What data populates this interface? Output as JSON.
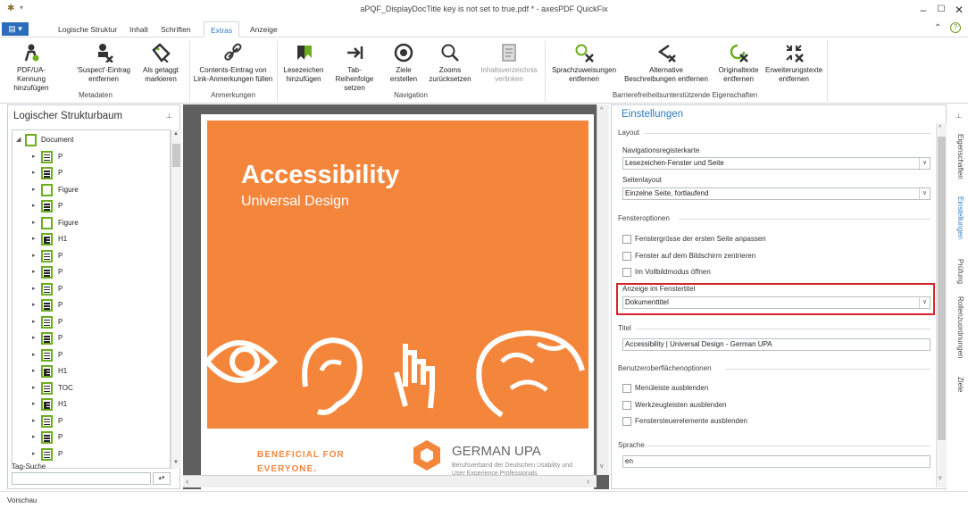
{
  "window": {
    "title": "aPQF_DisplayDocTitle key is not set to true.pdf * - axesPDF QuickFix",
    "minimize": "–",
    "maximize": "☐",
    "close": "✕"
  },
  "menu": {
    "app_button": "▤ ▾",
    "tabs": [
      "Logische Struktur",
      "Inhalt",
      "Schriften",
      "Extras",
      "Anzeige"
    ],
    "active_tab": "Extras",
    "collapse": "⌃",
    "help": "?"
  },
  "ribbon": {
    "metadaten": {
      "label": "Metadaten",
      "buttons": [
        "PDF/UA-Kennung\nhinzufügen",
        "'Suspect'-Eintrag\nentfernen",
        "Als getaggt\nmarkieren"
      ]
    },
    "anmerkungen": {
      "label": "Anmerkungen",
      "buttons": [
        "Contents-Eintrag von\nLink-Anmerkungen füllen"
      ]
    },
    "navigation": {
      "label": "Navigation",
      "buttons": [
        "Lesezeichen\nhinzufügen",
        "Tab-Reihenfolge\nsetzen",
        "Ziele\nerstellen",
        "Zooms\nzurücksetzen",
        "Inhaltsverzeichnis\nverlinken"
      ]
    },
    "barrierefreiheit": {
      "label": "Barrierefreiheitsunterstützende Eigenschaften",
      "buttons": [
        "Sprachzuweisungen\nentfernen",
        "Alternative\nBeschreibungen entfernen",
        "Originaltexte\nentfernen",
        "Erweiterungstexte\nentfernen"
      ]
    }
  },
  "left_panel": {
    "title": "Logischer Strukturbaum",
    "pin": "⊥",
    "tree": [
      {
        "label": "Document",
        "icon": "document"
      },
      {
        "label": "P",
        "icon": "paragraph"
      },
      {
        "label": "P",
        "icon": "paragraph"
      },
      {
        "label": "Figure",
        "icon": "figure"
      },
      {
        "label": "P",
        "icon": "paragraph"
      },
      {
        "label": "Figure",
        "icon": "figure"
      },
      {
        "label": "H1",
        "icon": "heading"
      },
      {
        "label": "P",
        "icon": "paragraph"
      },
      {
        "label": "P",
        "icon": "paragraph"
      },
      {
        "label": "P",
        "icon": "paragraph"
      },
      {
        "label": "P",
        "icon": "paragraph"
      },
      {
        "label": "P",
        "icon": "paragraph"
      },
      {
        "label": "P",
        "icon": "paragraph"
      },
      {
        "label": "P",
        "icon": "paragraph"
      },
      {
        "label": "H1",
        "icon": "heading"
      },
      {
        "label": "TOC",
        "icon": "toc"
      },
      {
        "label": "H1",
        "icon": "heading"
      },
      {
        "label": "P",
        "icon": "paragraph"
      },
      {
        "label": "P",
        "icon": "paragraph"
      },
      {
        "label": "P",
        "icon": "paragraph"
      }
    ],
    "tag_search_label": "Tag-Suche",
    "tag_search_value": ""
  },
  "document": {
    "title": "Accessibility",
    "subtitle": "Universal Design",
    "benefit": "BENEFICIAL FOR EVERYONE.",
    "org_name": "GERMAN UPA",
    "org_sub": "Berufsverband der Deutschen Usability und User Experience Professionals",
    "cover_color": "#f4863c"
  },
  "right_panel": {
    "title": "Einstellungen",
    "pin": "⊥",
    "layout_section": "Layout",
    "nav_label": "Navigationsregisterkarte",
    "nav_value": "Lesezeichen-Fenster und Seite",
    "seitenlayout_label": "Seitenlayout",
    "seitenlayout_value": "Einzelne Seite, fortlaufend",
    "fenster_section": "Fensteroptionen",
    "cb_resize": "Fenstergrösse der ersten Seite anpassen",
    "cb_center": "Fenster auf dem Bildschirm zentrieren",
    "cb_fullscreen": "Im Vollbildmodus öffnen",
    "anzeige_label": "Anzeige im Fenstertitel",
    "anzeige_value": "Dokumenttitel",
    "titel_section": "Titel",
    "titel_value": "Accessibility | Universal Design - German UPA",
    "ui_section": "Benutzeroberflächenoptionen",
    "cb_menu": "Menüleiste ausblenden",
    "cb_tools": "Werkzeugleisten ausblenden",
    "cb_controls": "Fenstersteuerelemente ausblenden",
    "sprache_section": "Sprache",
    "sprache_value": "en",
    "highlight_color": "#d6262b"
  },
  "side_tabs": [
    "Eigenschaften",
    "Einstellungen",
    "Prüfung",
    "Rollenzuordnungen",
    "Ziele"
  ],
  "active_side_tab": "Einstellungen",
  "status": "Vorschau"
}
